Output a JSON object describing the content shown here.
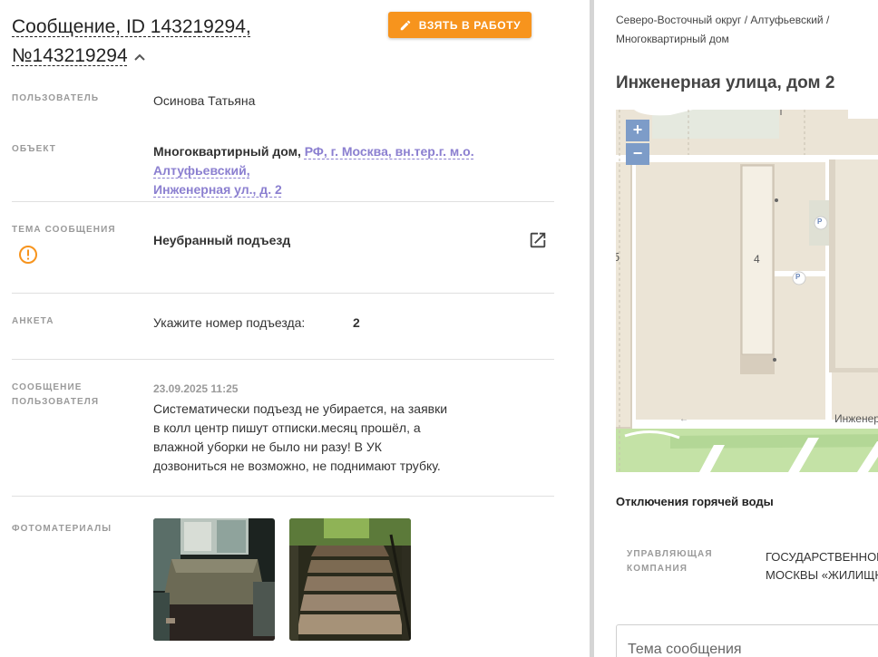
{
  "header": {
    "title_line1": "Сообщение, ID 143219294,",
    "title_line2": "№143219294",
    "take_button": "ВЗЯТЬ В РАБОТУ"
  },
  "fields": {
    "user_label": "ПОЛЬЗОВАТЕЛЬ",
    "user_value": "Осинова Татьяна",
    "object_label": "ОБЪЕКТ",
    "object_type": "Многоквартирный дом,",
    "object_address_line1": "РФ, г. Москва, вн.тер.г. м.о. Алтуфьевский,",
    "object_address_line2": "Инженерная ул., д. 2",
    "topic_label": "ТЕМА СООБЩЕНИЯ",
    "topic_value": "Неубранный подъезд",
    "survey_label": "АНКЕТА",
    "survey_question": "Укажите номер подъезда:",
    "survey_answer": "2",
    "message_label_line1": "СООБЩЕНИЕ",
    "message_label_line2": "ПОЛЬЗОВАТЕЛЯ",
    "message_date": "23.09.2025 11:25",
    "message_lines": [
      "Систематически подъезд не убирается, на заявки",
      "в колл центр пишут отписки.месяц прошёл, а",
      "влажной уборки не было ни разу! В УК",
      "дозвониться не возможно, не поднимают трубку."
    ],
    "photos_label": "ФОТОМАТЕРИАЛЫ"
  },
  "right": {
    "breadcrumb_line1": "Северо-Восточный округ / Алтуфьевский /",
    "breadcrumb_line2": "Многоквартирный дом",
    "address": "Инженерная улица, дом 2",
    "map": {
      "zoom_in": "+",
      "zoom_out": "−",
      "building_number": "4",
      "parking_marker": "P",
      "street_label": "Инженерная ул.",
      "building_label_left": "б"
    },
    "hot_water": "Отключения горячей воды",
    "uk_label_line1": "УПРАВЛЯЮЩАЯ",
    "uk_label_line2": "КОМПАНИЯ",
    "uk_value_line1": "ГОСУДАРСТВЕННОЕ",
    "uk_value_line2": "МОСКВЫ «ЖИЛИЩНИК»",
    "subject_placeholder": "Тема сообщения"
  },
  "colors": {
    "accent": "#f7941d",
    "link": "#8b7fd0",
    "warning": "#f7941d",
    "map_zoom": "#7d9cc8"
  }
}
